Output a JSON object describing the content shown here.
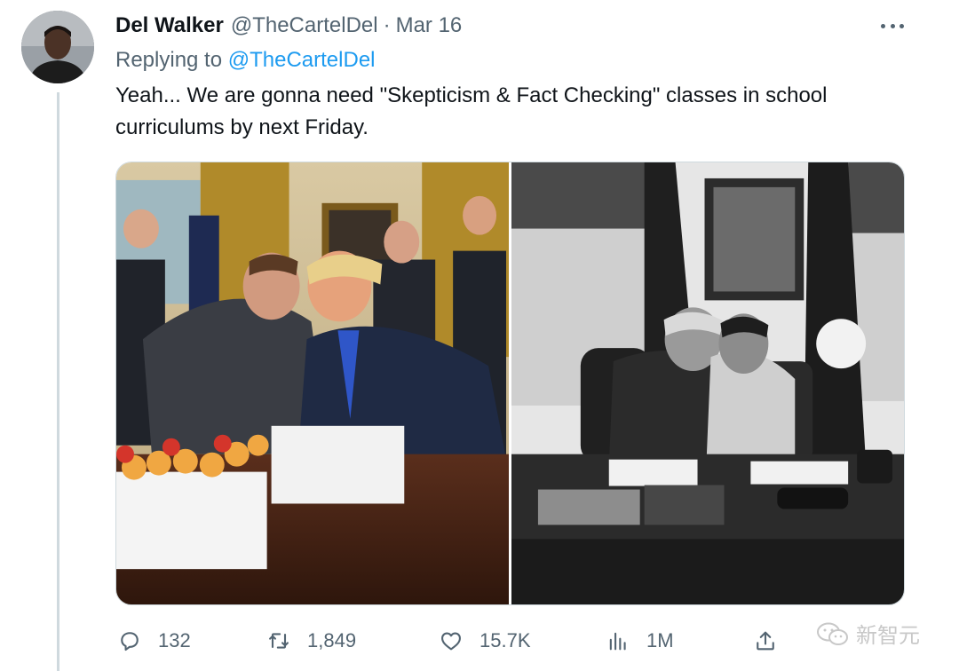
{
  "tweet": {
    "author_name": "Del Walker",
    "author_handle": "@TheCartelDel",
    "separator": "·",
    "date": "Mar 16",
    "replying_prefix": "Replying to ",
    "replying_handle": "@TheCartelDel",
    "text": "Yeah... We are gonna need \"Skepticism & Fact Checking\" classes in school curriculums by next Friday."
  },
  "icons": {
    "more": "more-horizontal-icon",
    "reply": "reply-bubble-icon",
    "retweet": "retweet-icon",
    "like": "heart-icon",
    "views": "bar-chart-icon",
    "share": "share-upload-icon"
  },
  "actions": {
    "reply_count": "132",
    "retweet_count": "1,849",
    "like_count": "15.7K",
    "view_count": "1M"
  },
  "watermark": {
    "text": "新智元"
  },
  "colors": {
    "link": "#1d9bf0",
    "secondary_text": "#536471",
    "primary_text": "#0f1419",
    "thread_line": "#cfd9de"
  }
}
